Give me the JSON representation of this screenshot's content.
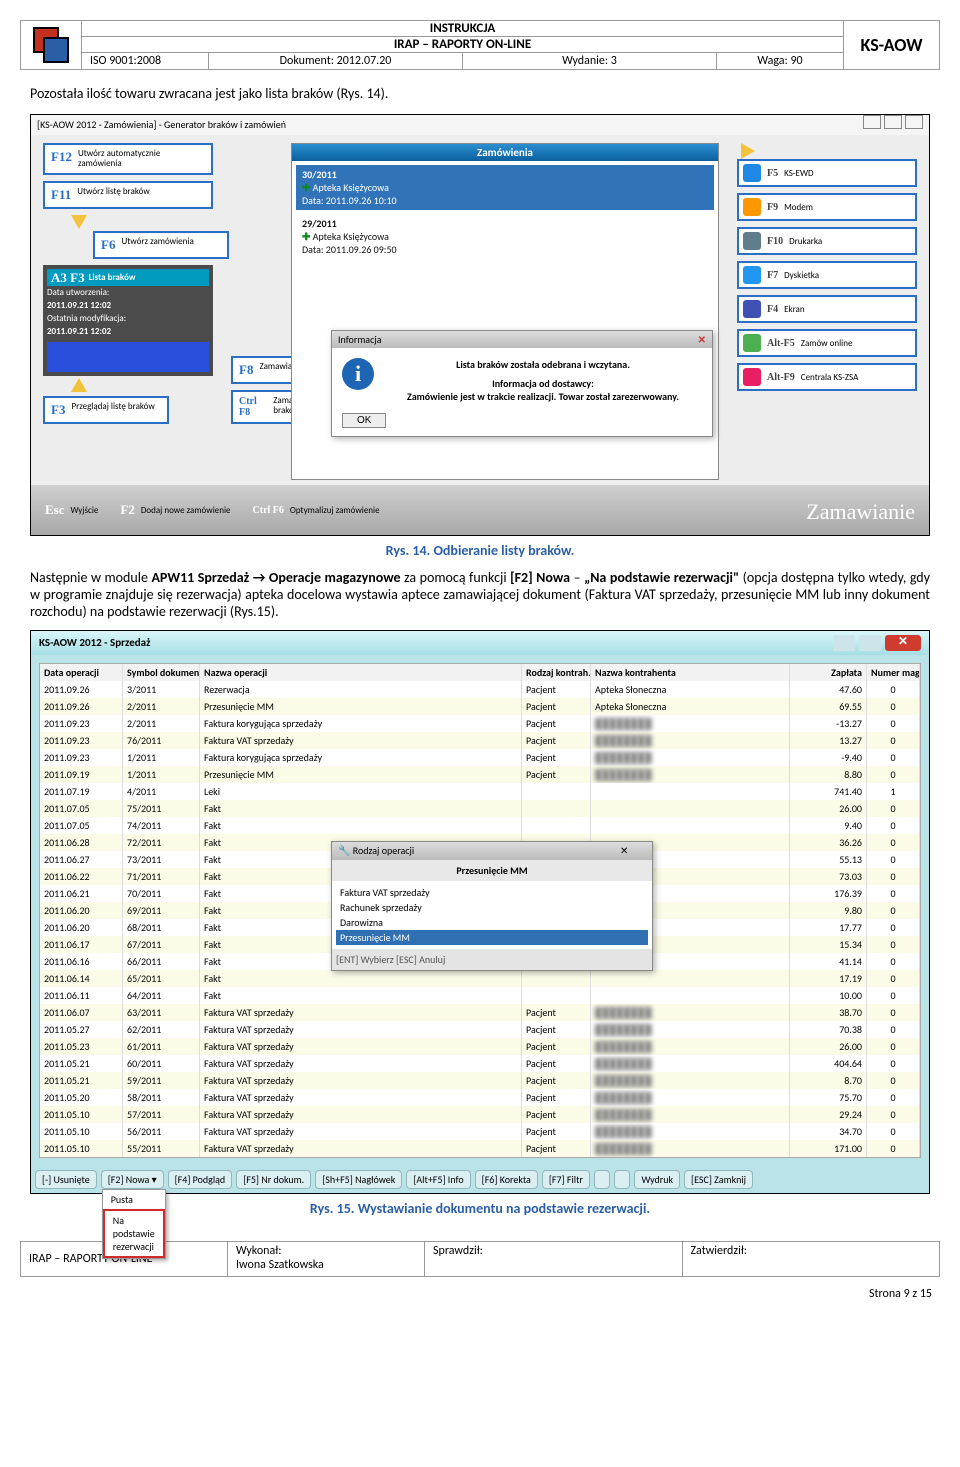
{
  "header": {
    "line1": "INSTRUKCJA",
    "line2": "IRAP – RAPORTY ON-LINE",
    "iso": "ISO 9001:2008",
    "dokument": "Dokument: 2012.07.20",
    "wydanie": "Wydanie: 3",
    "waga": "Waga: 90",
    "ks": "KS-AOW"
  },
  "p1": "Pozostała ilość towaru zwracana jest jako lista braków (Rys. 14).",
  "caption1": "Rys. 14. Odbieranie listy braków.",
  "para2_pre": "Następnie w module ",
  "para2_b1": "APW11 Sprzedaż → Operacje magazynowe",
  "para2_mid1": " za pomocą funkcji ",
  "para2_b2": "[F2] Nowa",
  "para2_mid2": " – ",
  "para2_b3": "„Na podstawie rezerwacji\"",
  "para2_tail": " (opcja dostępna tylko wtedy, gdy w programie znajduje się rezerwacja) apteka docelowa wystawia aptece zamawiającej dokument (Faktura VAT sprzedaży, przesunięcie MM lub inny dokument rozchodu) na podstawie rezerwacji (Rys.15).",
  "caption2": "Rys. 15. Wystawianie dokumentu na podstawie rezerwacji.",
  "shot1": {
    "title": "[KS-AOW 2012 - Zamówienia] - Generator braków i zamówień",
    "f12": {
      "k": "F12",
      "t": "Utwórz automatycznie zamówienia"
    },
    "f11": {
      "k": "F11",
      "t": "Utwórz listę braków"
    },
    "f6": {
      "k": "F6",
      "t": "Utwórz zamówienia"
    },
    "panel": {
      "ttl": "Lista braków",
      "l1": "Data utworzenia:",
      "v1": "2011.09.21    12:02",
      "l2": "Ostatnia modyfikacja:",
      "v2": "2011.09.21    12:02"
    },
    "f8": {
      "k": "F8",
      "t": "Zamawianie łączone"
    },
    "cf8": {
      "k": "Ctrl F8",
      "t": "Zamawianie z listy braków"
    },
    "f3": {
      "k": "F3",
      "t": "Przeglądaj listę braków"
    },
    "midbar": "Zamówienia",
    "ord1": {
      "a": "30/2011",
      "b": "Apteka Księżycowa",
      "c": "Data: 2011.09.26 10:10"
    },
    "ord2": {
      "a": "29/2011",
      "b": "Apteka Księżycowa",
      "c": "Data: 2011.09.26 09:50"
    },
    "info": {
      "t": "Informacja",
      "l1": "Lista braków została odebrana i wczytana.",
      "l2": "Informacja od dostawcy:",
      "l3": "Zamówienie jest w trakcie realizacji. Towar został zarezerwowany.",
      "ok": "OK"
    },
    "r": [
      {
        "k": "F5",
        "t": "KS-EWD"
      },
      {
        "k": "F9",
        "t": "Modem"
      },
      {
        "k": "F10",
        "t": "Drukarka"
      },
      {
        "k": "F7",
        "t": "Dyskietka"
      },
      {
        "k": "F4",
        "t": "Ekran"
      },
      {
        "k": "Alt-F5",
        "t": "Zamów online"
      },
      {
        "k": "Alt-F9",
        "t": "Centrala KS-ZSA"
      }
    ],
    "bot": {
      "esc": "Esc",
      "escT": "Wyjście",
      "f2": "F2",
      "f2T": "Dodaj nowe zamówienie",
      "cF6": "Ctrl F6",
      "cF6T": "Optymalizuj zamówienie"
    },
    "brand": "Zamawianie"
  },
  "shot2": {
    "title": "KS-AOW 2012 - Sprzedaż",
    "headers": [
      "Data operacji",
      "Symbol dokumentu",
      "Nazwa operacji",
      "Rodzaj kontrah.",
      "Nazwa kontrahenta",
      "Zapłata",
      "Numer magaz."
    ],
    "rows": [
      [
        "2011.09.26",
        "3/2011",
        "Rezerwacja",
        "Pacjent",
        "Apteka Słoneczna",
        "47.60",
        "0"
      ],
      [
        "2011.09.26",
        "2/2011",
        "Przesunięcie MM",
        "Pacjent",
        "Apteka Słoneczna",
        "69.55",
        "0"
      ],
      [
        "2011.09.23",
        "2/2011",
        "Faktura korygująca sprzedaży",
        "Pacjent",
        "blurred",
        "-13.27",
        "0"
      ],
      [
        "2011.09.23",
        "76/2011",
        "Faktura VAT sprzedaży",
        "Pacjent",
        "blurred",
        "13.27",
        "0"
      ],
      [
        "2011.09.23",
        "1/2011",
        "Faktura korygująca sprzedaży",
        "Pacjent",
        "blurred",
        "-9.40",
        "0"
      ],
      [
        "2011.09.19",
        "1/2011",
        "Przesunięcie MM",
        "Pacjent",
        "blurred",
        "8.80",
        "0"
      ],
      [
        "2011.07.19",
        "4/2011",
        "Leki",
        "",
        "",
        "741.40",
        "1"
      ],
      [
        "2011.07.05",
        "75/2011",
        "Fakt",
        "",
        "",
        "26.00",
        "0"
      ],
      [
        "2011.07.05",
        "74/2011",
        "Fakt",
        "",
        "",
        "9.40",
        "0"
      ],
      [
        "2011.06.28",
        "72/2011",
        "Fakt",
        "",
        "",
        "36.26",
        "0"
      ],
      [
        "2011.06.27",
        "73/2011",
        "Fakt",
        "",
        "",
        "55.13",
        "0"
      ],
      [
        "2011.06.22",
        "71/2011",
        "Fakt",
        "",
        "",
        "73.03",
        "0"
      ],
      [
        "2011.06.21",
        "70/2011",
        "Fakt",
        "",
        "",
        "176.39",
        "0"
      ],
      [
        "2011.06.20",
        "69/2011",
        "Fakt",
        "",
        "",
        "9.80",
        "0"
      ],
      [
        "2011.06.20",
        "68/2011",
        "Fakt",
        "",
        "",
        "17.77",
        "0"
      ],
      [
        "2011.06.17",
        "67/2011",
        "Fakt",
        "",
        "",
        "15.34",
        "0"
      ],
      [
        "2011.06.16",
        "66/2011",
        "Fakt",
        "",
        "",
        "41.14",
        "0"
      ],
      [
        "2011.06.14",
        "65/2011",
        "Fakt",
        "",
        "",
        "17.19",
        "0"
      ],
      [
        "2011.06.11",
        "64/2011",
        "Fakt",
        "",
        "",
        "10.00",
        "0"
      ],
      [
        "2011.06.07",
        "63/2011",
        "Faktura VAT sprzedaży",
        "Pacjent",
        "blurred",
        "38.70",
        "0"
      ],
      [
        "2011.05.27",
        "62/2011",
        "Faktura VAT sprzedaży",
        "Pacjent",
        "blurred",
        "70.38",
        "0"
      ],
      [
        "2011.05.23",
        "61/2011",
        "Faktura VAT sprzedaży",
        "Pacjent",
        "blurred",
        "26.00",
        "0"
      ],
      [
        "2011.05.21",
        "60/2011",
        "Faktura VAT sprzedaży",
        "Pacjent",
        "blurred",
        "404.64",
        "0"
      ],
      [
        "2011.05.21",
        "59/2011",
        "Faktura VAT sprzedaży",
        "Pacjent",
        "blurred",
        "8.70",
        "0"
      ],
      [
        "2011.05.20",
        "58/2011",
        "Faktura VAT sprzedaży",
        "Pacjent",
        "blurred",
        "75.70",
        "0"
      ],
      [
        "2011.05.10",
        "57/2011",
        "Faktura VAT sprzedaży",
        "Pacjent",
        "blurred",
        "29.24",
        "0"
      ],
      [
        "2011.05.10",
        "56/2011",
        "Faktura VAT sprzedaży",
        "Pacjent",
        "blurred",
        "34.70",
        "0"
      ],
      [
        "2011.05.10",
        "55/2011",
        "Faktura VAT sprzedaży",
        "Pacjent",
        "blurred",
        "171.00",
        "0"
      ]
    ],
    "pop": {
      "title": "Rodzaj operacji",
      "heading": "Przesunięcie MM",
      "items": [
        "Faktura VAT sprzedaży",
        "Rachunek sprzedaży",
        "Darowizna",
        "Przesunięcie MM"
      ],
      "ft": "[ENT] Wybierz   [ESC] Anuluj"
    },
    "bbar": [
      "[-] Usunięte",
      "[F2] Nowa ▾",
      "[F4] Podgląd",
      "[F5] Nr dokum.",
      "[Sh+F5] Nagłówek",
      "[Alt+F5] Info",
      "[F6] Korekta",
      "[F7] Filtr",
      "",
      "",
      "Wydruk",
      "[ESC] Zamknij"
    ],
    "menu": [
      "Pusta",
      "Na podstawie rezerwacji"
    ]
  },
  "footer": {
    "c1": "IRAP – RAPORTY ON-LINE",
    "c2a": "Wykonał:",
    "c2b": "Iwona Szatkowska",
    "c3": "Sprawdził:",
    "c4": "Zatwierdził:",
    "page": "Strona 9 z 15"
  }
}
